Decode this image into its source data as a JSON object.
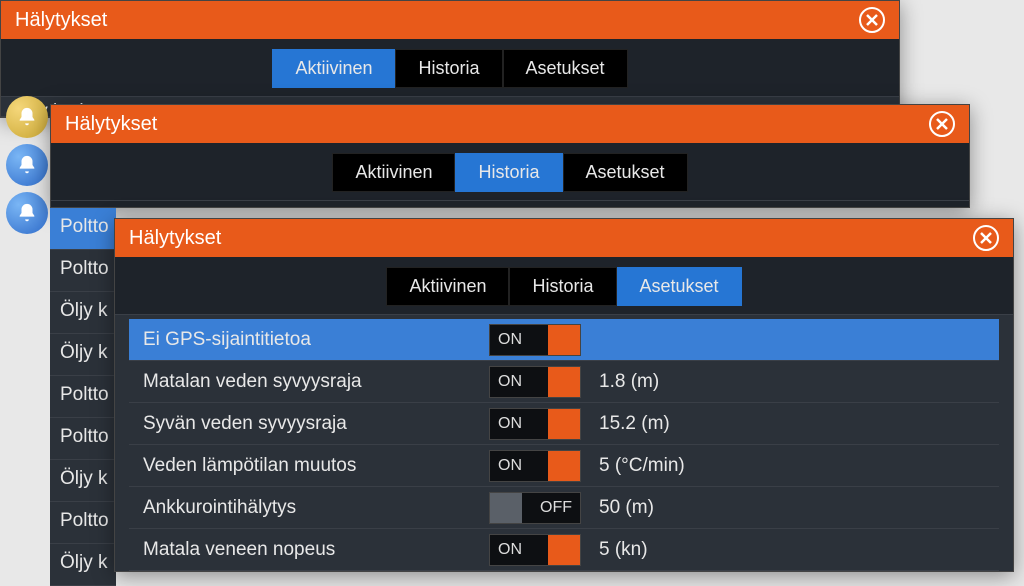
{
  "window_title": "Hälytykset",
  "tabs": {
    "active": "Aktiivinen",
    "history": "Historia",
    "settings": "Asetukset"
  },
  "w1": {
    "truncated_item": "Öljy korkea"
  },
  "w2": {
    "peek_items": [
      "Poltto",
      "Poltto",
      "Öljy k",
      "Öljy k",
      "Poltto",
      "Poltto",
      "Öljy k",
      "Poltto",
      "Öljy k"
    ]
  },
  "settings_rows": [
    {
      "label": "Ei GPS-sijaintitietoa",
      "state": "ON",
      "on": true,
      "value": "",
      "selected": true
    },
    {
      "label": "Matalan veden syvyysraja",
      "state": "ON",
      "on": true,
      "value": "1.8 (m)",
      "selected": false
    },
    {
      "label": "Syvän veden syvyysraja",
      "state": "ON",
      "on": true,
      "value": "15.2 (m)",
      "selected": false
    },
    {
      "label": "Veden lämpötilan muutos",
      "state": "ON",
      "on": true,
      "value": "5 (°C/min)",
      "selected": false
    },
    {
      "label": "Ankkurointihälytys",
      "state": "OFF",
      "on": false,
      "value": "50 (m)",
      "selected": false
    },
    {
      "label": "Matala veneen nopeus",
      "state": "ON",
      "on": true,
      "value": "5 (kn)",
      "selected": false
    }
  ]
}
